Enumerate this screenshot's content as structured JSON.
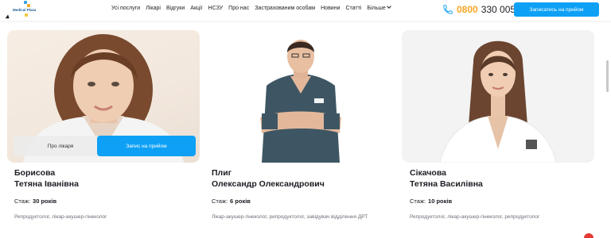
{
  "header": {
    "logo_text": "Medical Plaza",
    "nav": [
      "Усі послуги",
      "Лікарі",
      "Відгуки",
      "Акції",
      "НСЗУ",
      "Про нас",
      "Застрахованим особам",
      "Новини",
      "Статті",
      "Більше"
    ],
    "phone_prefix": "0800",
    "phone_number": "330 005",
    "cta_label": "Записатись на прийом"
  },
  "doctors": [
    {
      "surname": "Борисова",
      "given": "Тетяна Іванівна",
      "experience_label": "Стаж:",
      "experience_value": "30 років",
      "specialty": "Репродуктолог, лікар-акушер-гінеколог",
      "about_label": "Про лікаря",
      "book_label": "Запис на прийом"
    },
    {
      "surname": "Плиг",
      "given": "Олександр Олександрович",
      "experience_label": "Стаж:",
      "experience_value": "6 років",
      "specialty": "Лікар-акушер-гінеколог, репродуктолог, завідувач відділення ДРТ"
    },
    {
      "surname": "Сікачова",
      "given": "Тетяна Василівна",
      "experience_label": "Стаж:",
      "experience_value": "10 років",
      "specialty": "Репродуктолог, лікар-акушер-гінеколог, репродуктолог"
    }
  ],
  "colors": {
    "accent": "#0ea0f5",
    "phone_prefix": "#f5a623"
  }
}
